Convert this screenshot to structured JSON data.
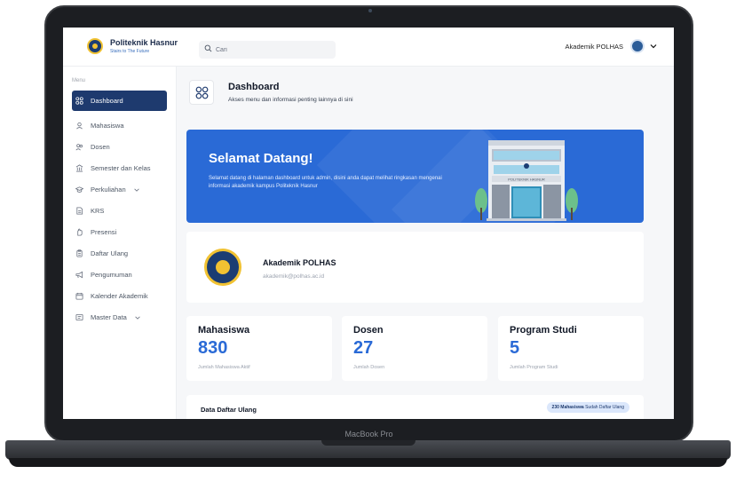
{
  "device": {
    "label": "MacBook Pro"
  },
  "app": {
    "name": "Politeknik Hasnur",
    "tagline": "Stairs to The Future"
  },
  "search": {
    "placeholder": "Cari"
  },
  "user": {
    "name": "Akademik POLHAS"
  },
  "sidebar": {
    "menu_label": "Menu",
    "items": [
      {
        "label": "Dashboard",
        "icon": "grid-icon",
        "active": true
      },
      {
        "label": "Mahasiswa",
        "icon": "student-icon"
      },
      {
        "label": "Dosen",
        "icon": "users-icon"
      },
      {
        "label": "Semester dan Kelas",
        "icon": "building-icon"
      },
      {
        "label": "Perkuliahan",
        "icon": "graduation-icon",
        "has_submenu": true
      },
      {
        "label": "KRS",
        "icon": "document-icon"
      },
      {
        "label": "Presensi",
        "icon": "hand-icon"
      },
      {
        "label": "Daftar Ulang",
        "icon": "clipboard-icon"
      },
      {
        "label": "Pengumuman",
        "icon": "megaphone-icon"
      },
      {
        "label": "Kalender Akademik",
        "icon": "calendar-icon"
      },
      {
        "label": "Master Data",
        "icon": "database-icon",
        "has_submenu": true
      }
    ]
  },
  "header": {
    "title": "Dashboard",
    "description": "Akses menu dan informasi penting lainnya di sini"
  },
  "banner": {
    "title": "Selamat Datang!",
    "text": "Selamat datang di halaman dashboard untuk admin, disini anda dapat melihat ringkasan mengenai informasi akademik kampus Politeknik Hasnur",
    "building_sign": "POLITEKNIK HASNUR"
  },
  "profile": {
    "name": "Akademik POLHAS",
    "email": "akademik@polhas.ac.id"
  },
  "stats": [
    {
      "title": "Mahasiswa",
      "value": "830",
      "caption": "Jumlah Mahasiswa Aktif"
    },
    {
      "title": "Dosen",
      "value": "27",
      "caption": "Jumlah Dosen"
    },
    {
      "title": "Program Studi",
      "value": "5",
      "caption": "Jumlah Program Studi"
    }
  ],
  "registration": {
    "title": "Data Daftar Ulang",
    "badge_count": "230 Mahasiswa",
    "badge_text": "Sudah Daftar Ulang"
  },
  "colors": {
    "primary": "#2a6ad6",
    "sidebar_active": "#1e3a6e",
    "logo_gold": "#f1c232"
  }
}
